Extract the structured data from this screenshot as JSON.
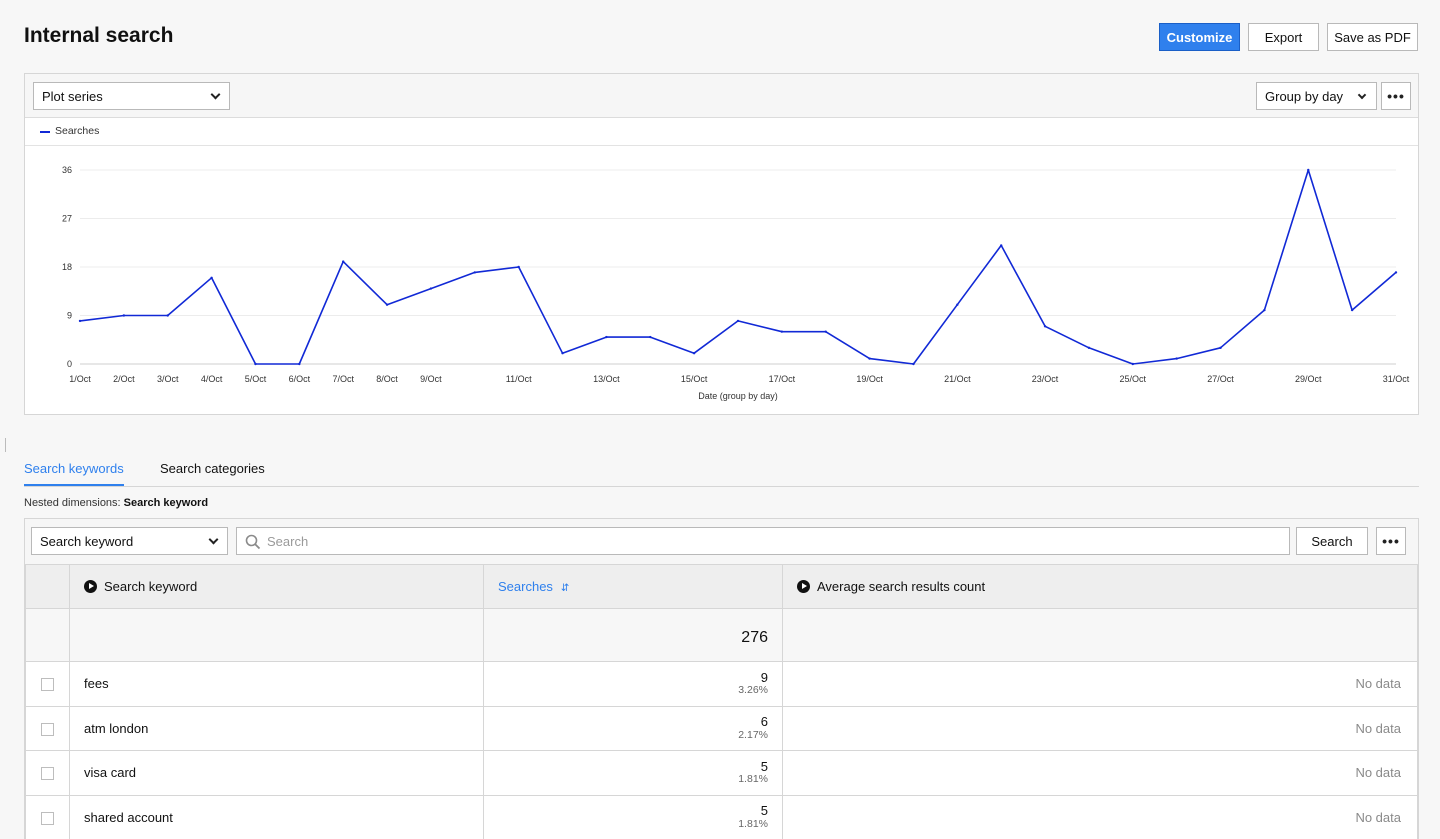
{
  "header": {
    "title": "Internal search",
    "customize_label": "Customize",
    "export_label": "Export",
    "save_pdf_label": "Save as PDF"
  },
  "chart_toolbar": {
    "plot_series_label": "Plot series",
    "group_by_label": "Group by day",
    "more_label": "•••"
  },
  "chart_data": {
    "type": "line",
    "x": [
      "1/Oct",
      "2/Oct",
      "3/Oct",
      "4/Oct",
      "5/Oct",
      "6/Oct",
      "7/Oct",
      "8/Oct",
      "9/Oct",
      "10/Oct",
      "11/Oct",
      "12/Oct",
      "13/Oct",
      "14/Oct",
      "15/Oct",
      "16/Oct",
      "17/Oct",
      "18/Oct",
      "19/Oct",
      "20/Oct",
      "21/Oct",
      "22/Oct",
      "23/Oct",
      "24/Oct",
      "25/Oct",
      "26/Oct",
      "27/Oct",
      "28/Oct",
      "29/Oct",
      "30/Oct",
      "31/Oct"
    ],
    "tick_labels": [
      "1/Oct",
      "2/Oct",
      "3/Oct",
      "4/Oct",
      "5/Oct",
      "6/Oct",
      "7/Oct",
      "8/Oct",
      "9/Oct",
      "",
      "11/Oct",
      "",
      "13/Oct",
      "",
      "15/Oct",
      "",
      "17/Oct",
      "",
      "19/Oct",
      "",
      "21/Oct",
      "",
      "23/Oct",
      "",
      "25/Oct",
      "",
      "27/Oct",
      "",
      "29/Oct",
      "",
      "31/Oct"
    ],
    "series": [
      {
        "name": "Searches",
        "color": "#1129d6",
        "values": [
          8,
          9,
          9,
          16,
          0,
          0,
          19,
          11,
          14,
          17,
          18,
          2,
          5,
          5,
          2,
          8,
          6,
          6,
          1,
          0,
          11,
          22,
          7,
          3,
          0,
          1,
          3,
          10,
          36,
          10,
          17
        ]
      }
    ],
    "xlabel": "Date (group by day)",
    "ylabel": "",
    "yticks": [
      0,
      9,
      18,
      27,
      36
    ],
    "ylim": [
      0,
      36
    ],
    "grid": true,
    "legend": "top-left"
  },
  "tabs": [
    {
      "label": "Search keywords",
      "active": true
    },
    {
      "label": "Search categories",
      "active": false
    }
  ],
  "nested": {
    "prefix": "Nested dimensions:",
    "value": "Search keyword"
  },
  "table_toolbar": {
    "dimension_select": "Search keyword",
    "search_placeholder": "Search",
    "search_button": "Search",
    "more_label": "•••"
  },
  "table": {
    "columns": [
      "Search keyword",
      "Searches",
      "Average search results count"
    ],
    "total": "276",
    "rows": [
      {
        "keyword": "fees",
        "searches": "9",
        "percent": "3.26%",
        "avg": "No data"
      },
      {
        "keyword": "atm london",
        "searches": "6",
        "percent": "2.17%",
        "avg": "No data"
      },
      {
        "keyword": "visa card",
        "searches": "5",
        "percent": "1.81%",
        "avg": "No data"
      },
      {
        "keyword": "shared account",
        "searches": "5",
        "percent": "1.81%",
        "avg": "No data"
      }
    ]
  }
}
